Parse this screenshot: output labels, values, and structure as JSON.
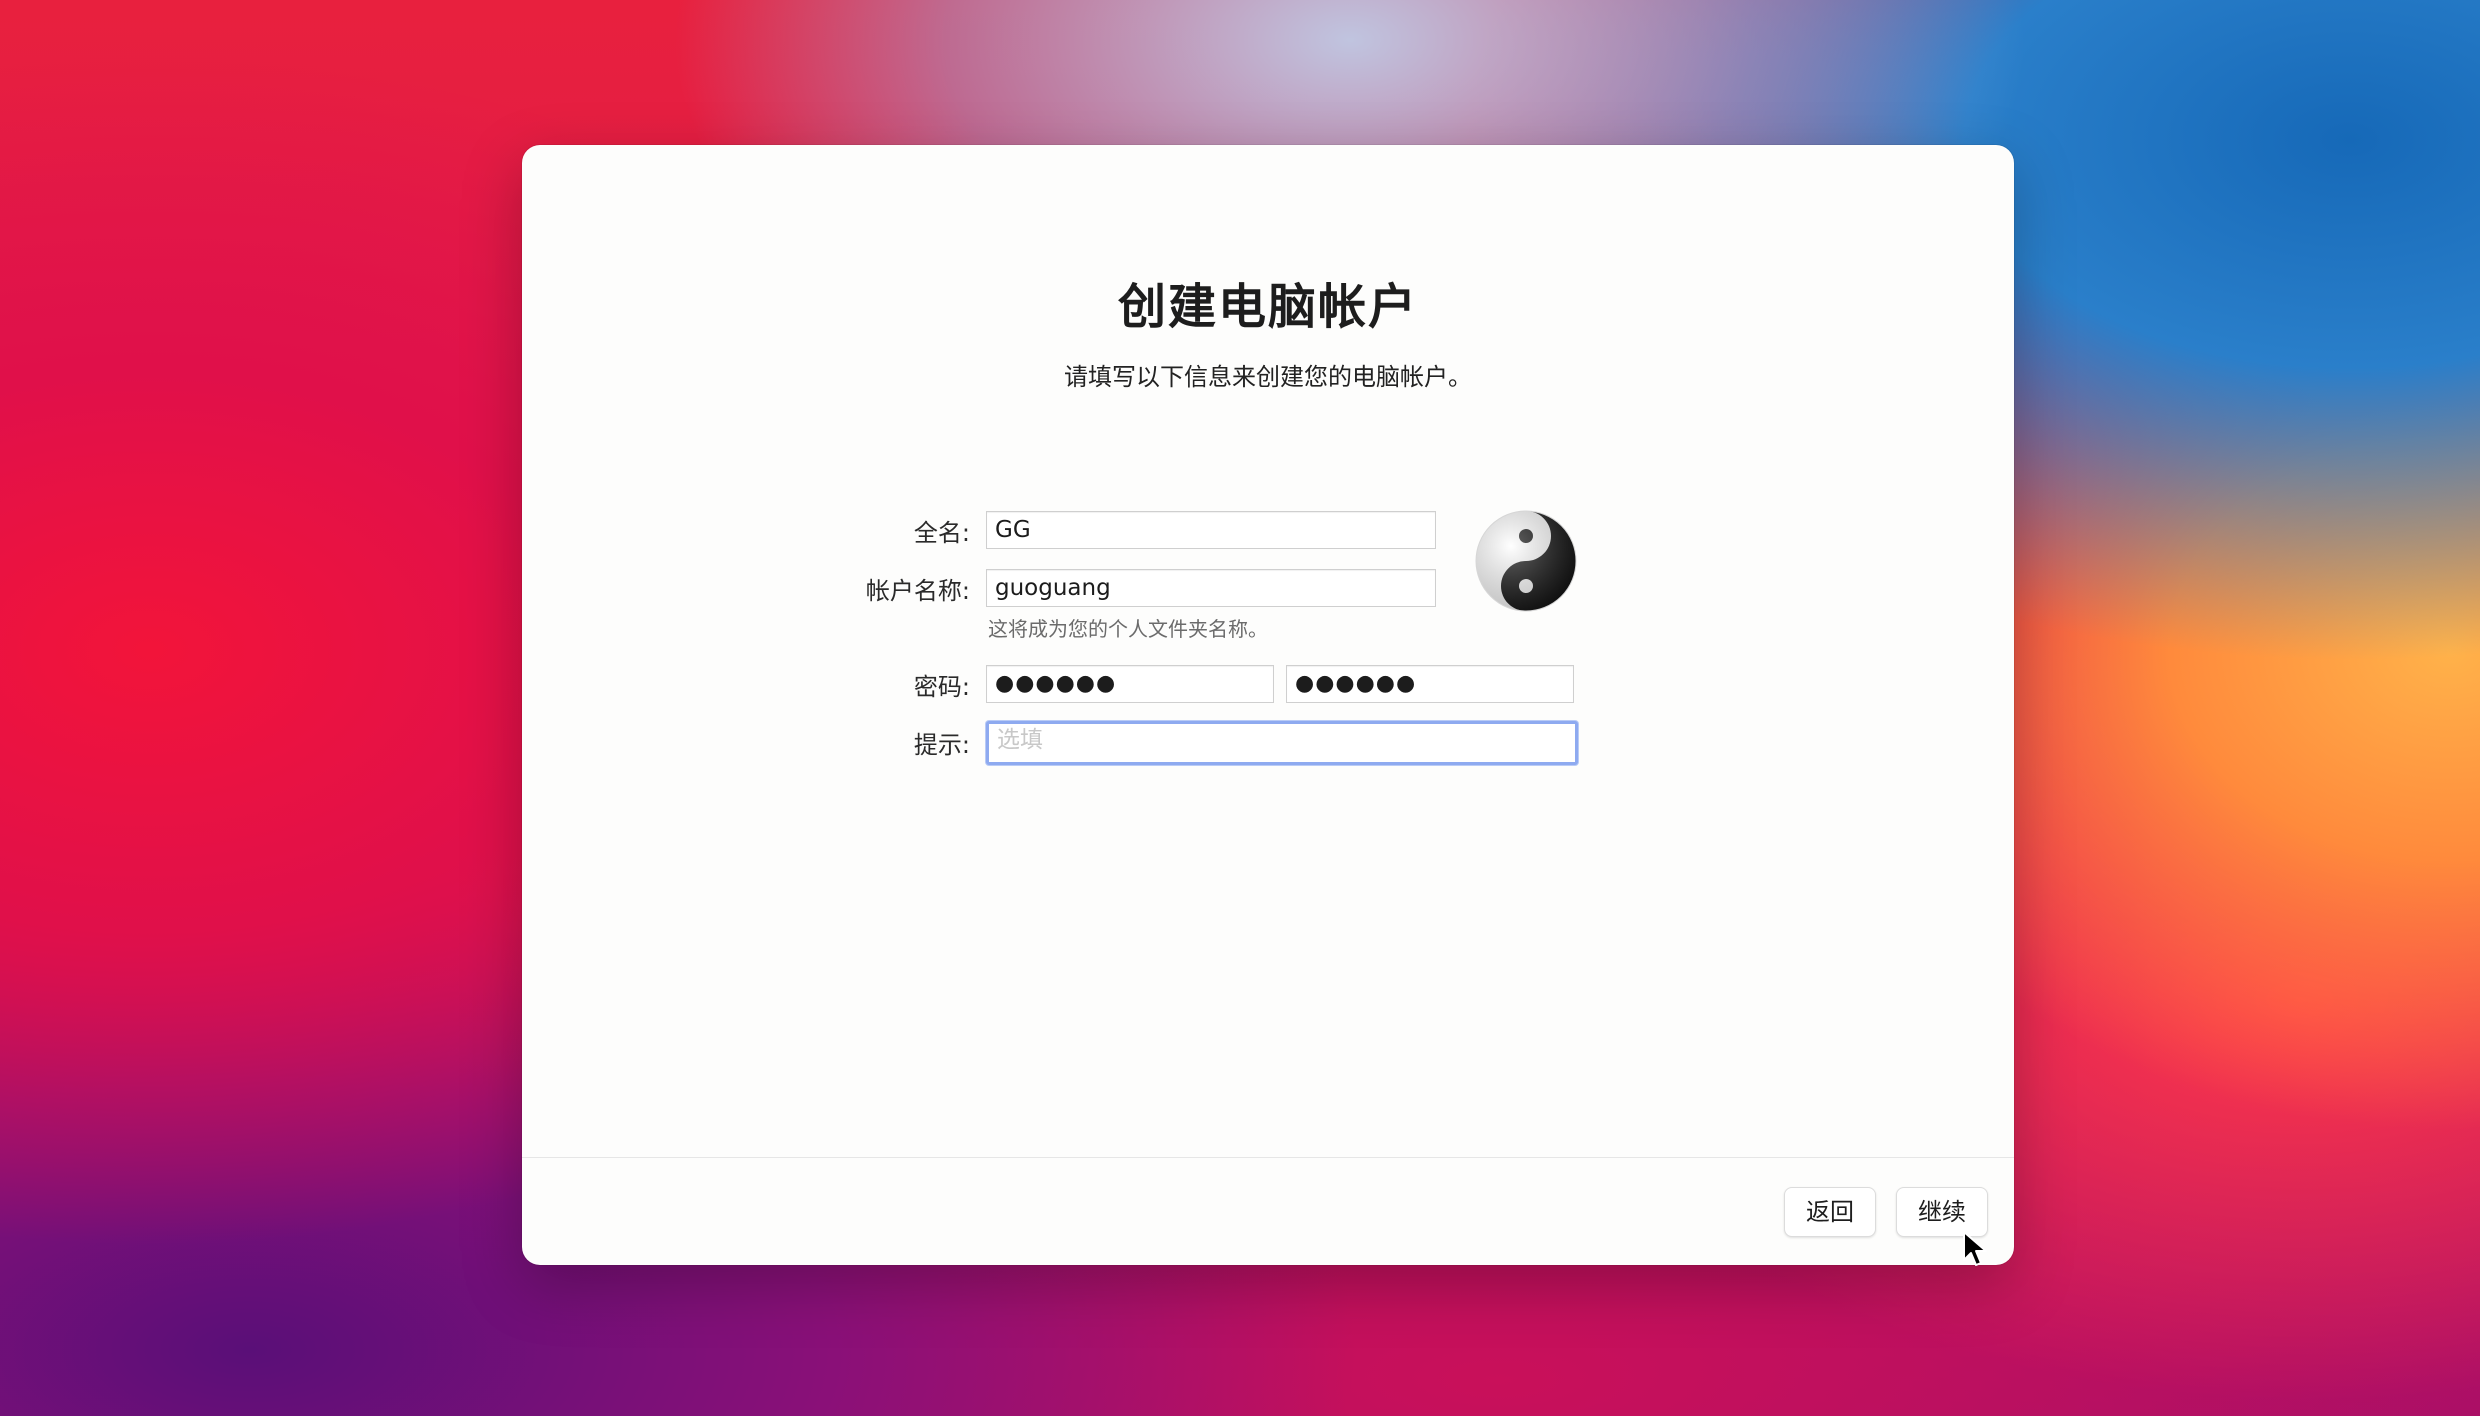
{
  "window": {
    "title": "创建电脑帐户",
    "subtitle": "请填写以下信息来创建您的电脑帐户。"
  },
  "form": {
    "full_name": {
      "label": "全名:",
      "value": "GG"
    },
    "account_name": {
      "label": "帐户名称:",
      "value": "guoguang",
      "note": "这将成为您的个人文件夹名称。"
    },
    "password": {
      "label": "密码:",
      "value": "●●●●●●",
      "verify_value": "●●●●●●"
    },
    "hint": {
      "label": "提示:",
      "placeholder": "选填",
      "value": ""
    }
  },
  "avatar": {
    "icon": "yin-yang-icon"
  },
  "buttons": {
    "back": "返回",
    "continue": "继续"
  },
  "colors": {
    "window_background": "#fdfdfc",
    "focus_ring": "#8eaaf0"
  }
}
